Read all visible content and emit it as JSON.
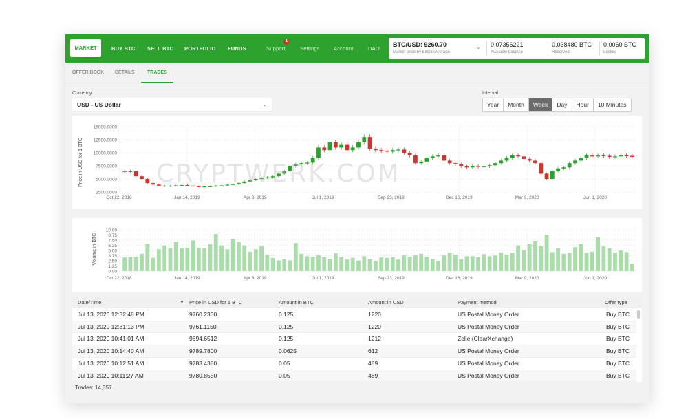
{
  "nav": {
    "items": [
      "MARKET",
      "BUY BTC",
      "SELL BTC",
      "PORTFOLIO",
      "FUNDS",
      "Support",
      "Settings",
      "Account",
      "DAO"
    ],
    "support_badge": "1"
  },
  "ticker": {
    "pair": "BTC/USD: 9260.70",
    "pair_sub": "Market price by BitcoinAverage",
    "balance": "0.07356221",
    "balance_label": "Available balance",
    "reserved": "0.038480 BTC",
    "reserved_label": "Reserved",
    "locked": "0.0060 BTC",
    "locked_label": "Locked"
  },
  "subtabs": [
    "OFFER BOOK",
    "DETAILS",
    "TRADES"
  ],
  "currency": {
    "label": "Currency",
    "selected": "USD  -  US Dollar"
  },
  "interval": {
    "label": "Interval",
    "options": [
      "Year",
      "Month",
      "Week",
      "Day",
      "Hour",
      "10 Minutes"
    ],
    "selected": "Week"
  },
  "watermark": "CRYPTWERK.COM",
  "colors": {
    "brand_green": "#2ea22e",
    "candle_up": "#2ca02c",
    "candle_down": "#d0342c",
    "volume_bar": "#a8dca8"
  },
  "chart_data": [
    {
      "type": "candlestick",
      "ylabel": "Price in USD for 1 BTC",
      "ylim": [
        2500,
        15000
      ],
      "y_ticks": [
        "15000.0000",
        "12500.0000",
        "10000.0000",
        "7500.0000",
        "5000.0000",
        "2500.0000"
      ],
      "x_ticks": [
        "Oct 22, 2018",
        "Jan 14, 2019",
        "Apr 8, 2019",
        "Jul 1, 2019",
        "Sep 23, 2019",
        "Dec 16, 2019",
        "Mar 9, 2020",
        "Jun 1, 2020"
      ],
      "grid": true,
      "close": [
        6500,
        6450,
        5500,
        5000,
        4200,
        3900,
        3700,
        3600,
        3700,
        3750,
        3800,
        3700,
        3600,
        3500,
        3550,
        3600,
        3700,
        3750,
        3900,
        4000,
        4200,
        4500,
        4800,
        5000,
        5200,
        5300,
        5500,
        6000,
        6500,
        7500,
        7800,
        8000,
        8100,
        9000,
        11000,
        10500,
        12000,
        11000,
        11500,
        10500,
        11000,
        12000,
        13000,
        10800,
        10500,
        10400,
        10200,
        10500,
        10600,
        10000,
        9500,
        8000,
        8300,
        9000,
        9300,
        9500,
        8500,
        8000,
        7800,
        7400,
        7200,
        7500,
        7300,
        7400,
        7600,
        8000,
        8500,
        9000,
        9500,
        9300,
        8800,
        8500,
        8000,
        6000,
        5000,
        6500,
        7000,
        7200,
        8000,
        8500,
        9000,
        9500,
        9300,
        9500,
        9400,
        9200,
        9300,
        9500,
        9400,
        9200
      ]
    },
    {
      "type": "bar",
      "ylabel": "Volume in BTC",
      "ylim": [
        0,
        10
      ],
      "y_ticks": [
        "10.00",
        "8.75",
        "7.50",
        "6.25",
        "5.00",
        "3.75",
        "2.50",
        "1.25",
        "0.00"
      ],
      "x_ticks": [
        "Oct 22, 2018",
        "Jan 14, 2019",
        "Apr 8, 2019",
        "Jul 1, 2019",
        "Sep 23, 2019",
        "Dec 16, 2019",
        "Mar 9, 2020",
        "Jun 1, 2020"
      ],
      "values": [
        3.3,
        3.5,
        3.5,
        4.2,
        6.6,
        3.2,
        5.3,
        6.2,
        5.5,
        7.0,
        5.6,
        5.7,
        7.4,
        5.7,
        5.6,
        6.5,
        9.0,
        6.2,
        5.3,
        7.8,
        7.0,
        6.2,
        4.7,
        5.3,
        6.0,
        4.0,
        3.2,
        2.6,
        3.0,
        2.6,
        6.8,
        4.2,
        3.6,
        3.5,
        3.8,
        3.4,
        3.0,
        4.3,
        3.4,
        2.8,
        3.2,
        2.5,
        3.6,
        3.0,
        2.4,
        3.3,
        3.2,
        3.4,
        2.8,
        3.8,
        3.5,
        3.8,
        4.2,
        3.5,
        3.0,
        2.4,
        3.8,
        4.5,
        4.0,
        2.9,
        3.6,
        3.6,
        3.4,
        4.1,
        3.6,
        3.8,
        4.5,
        4.0,
        4.4,
        6.2,
        5.1,
        6.5,
        7.2,
        6.0,
        8.8,
        4.6,
        5.5,
        4.2,
        4.4,
        5.8,
        6.5,
        4.4,
        4.7,
        8.2,
        6.0,
        5.5,
        4.5,
        5.0,
        4.6,
        1.8
      ]
    }
  ],
  "table": {
    "columns": [
      "Date/Time",
      "Price in USD for 1 BTC",
      "Amount in BTC",
      "Amount in USD",
      "Payment method",
      "Offer type"
    ],
    "rows": [
      [
        "Jul 13, 2020 12:32:48 PM",
        "9760.2330",
        "0.125",
        "1220",
        "US Postal Money Order",
        "Buy BTC"
      ],
      [
        "Jul 13, 2020 12:31:13 PM",
        "9761.1150",
        "0.125",
        "1220",
        "US Postal Money Order",
        "Buy BTC"
      ],
      [
        "Jul 13, 2020 10:41:01 AM",
        "9694.6512",
        "0.125",
        "1212",
        "Zelle (ClearXchange)",
        "Buy BTC"
      ],
      [
        "Jul 13, 2020 10:14:40 AM",
        "9789.7800",
        "0.0625",
        "612",
        "US Postal Money Order",
        "Buy BTC"
      ],
      [
        "Jul 13, 2020 10:12:51 AM",
        "9783.4380",
        "0.05",
        "489",
        "US Postal Money Order",
        "Buy BTC"
      ],
      [
        "Jul 13, 2020 10:11:27 AM",
        "9780.8550",
        "0.05",
        "489",
        "US Postal Money Order",
        "Buy BTC"
      ]
    ],
    "trades_count": "Trades: 14,357"
  }
}
